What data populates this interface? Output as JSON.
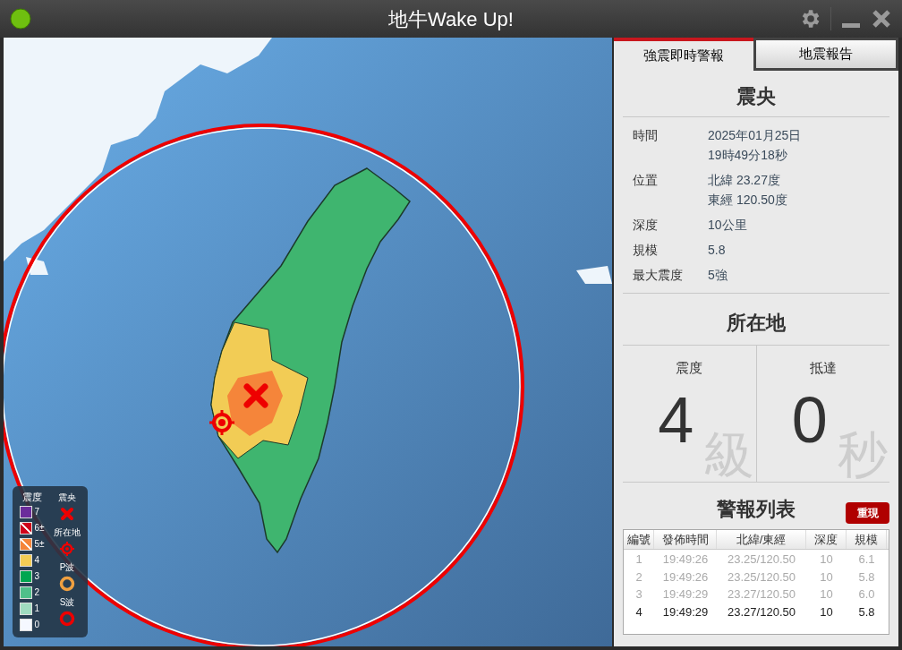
{
  "window": {
    "title": "地牛Wake Up!"
  },
  "tabs": [
    {
      "label": "強震即時警報",
      "selected": true
    },
    {
      "label": "地震報告",
      "selected": false
    }
  ],
  "epicenter": {
    "heading": "震央",
    "fields": [
      {
        "label": "時間",
        "lines": [
          "2025年01月25日",
          "19時49分18秒"
        ]
      },
      {
        "label": "位置",
        "lines": [
          "北緯 23.27度",
          "東經 120.50度"
        ]
      },
      {
        "label": "深度",
        "lines": [
          "10公里"
        ]
      },
      {
        "label": "規模",
        "lines": [
          "5.8"
        ]
      },
      {
        "label": "最大震度",
        "lines": [
          "5強"
        ]
      }
    ]
  },
  "location": {
    "heading": "所在地",
    "cards": [
      {
        "label": "震度",
        "value": "4",
        "unit": "級"
      },
      {
        "label": "抵達",
        "value": "0",
        "unit": "秒"
      }
    ]
  },
  "alerts": {
    "heading": "警報列表",
    "replay_button": "重現",
    "columns": [
      "編號",
      "發佈時間",
      "北緯/東經",
      "深度",
      "規模"
    ],
    "rows": [
      {
        "cells": [
          "1",
          "19:49:26",
          "23.25/120.50",
          "10",
          "6.1"
        ],
        "latest": false
      },
      {
        "cells": [
          "2",
          "19:49:26",
          "23.25/120.50",
          "10",
          "5.8"
        ],
        "latest": false
      },
      {
        "cells": [
          "3",
          "19:49:29",
          "23.27/120.50",
          "10",
          "6.0"
        ],
        "latest": false
      },
      {
        "cells": [
          "4",
          "19:49:29",
          "23.27/120.50",
          "10",
          "5.8"
        ],
        "latest": true
      }
    ]
  },
  "legend": {
    "intensity_heading": "震度",
    "intensity_levels": [
      {
        "label": "7",
        "color": "#6b2c9b",
        "kind": "solid"
      },
      {
        "label": "6±",
        "color": "#d0021b",
        "kind": "split"
      },
      {
        "label": "5±",
        "color": "#f5853a",
        "kind": "split"
      },
      {
        "label": "4",
        "color": "#f2cc55",
        "kind": "solid"
      },
      {
        "label": "3",
        "color": "#00a650",
        "kind": "solid"
      },
      {
        "label": "2",
        "color": "#4fc08a",
        "kind": "solid"
      },
      {
        "label": "1",
        "color": "#a0dcc0",
        "kind": "solid"
      },
      {
        "label": "0",
        "color": "#f5f8ff",
        "kind": "solid"
      }
    ],
    "markers": [
      {
        "label": "震央",
        "kind": "epicenter"
      },
      {
        "label": "所在地",
        "kind": "location"
      },
      {
        "label": "P波",
        "kind": "p_wave"
      },
      {
        "label": "S波",
        "kind": "s_wave"
      }
    ]
  }
}
